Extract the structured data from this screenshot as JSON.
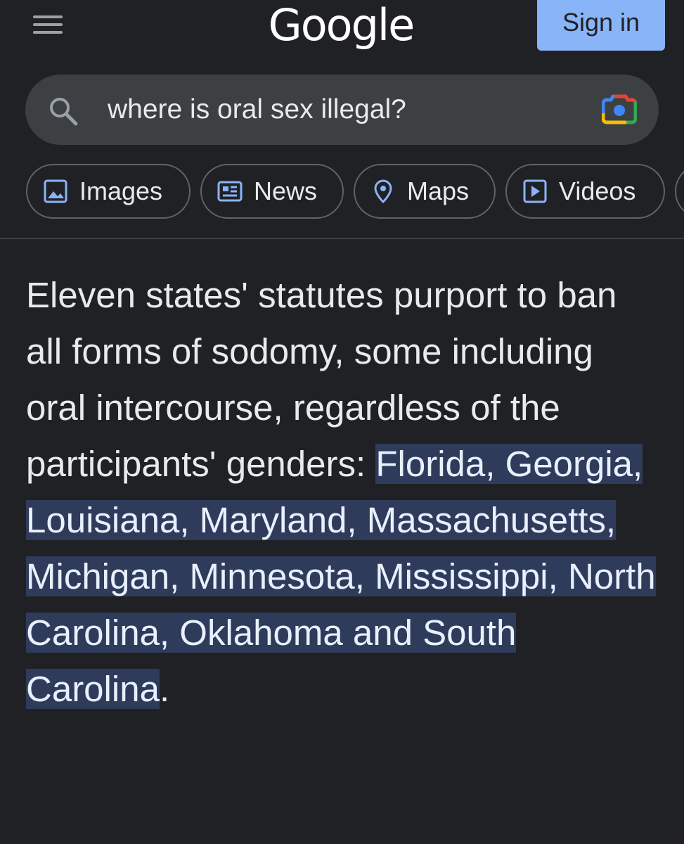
{
  "header": {
    "logo_text": "Google",
    "signin_label": "Sign in"
  },
  "search": {
    "query": "where is oral sex illegal?"
  },
  "tabs": [
    {
      "label": "Images",
      "icon": "image-icon"
    },
    {
      "label": "News",
      "icon": "newspaper-icon"
    },
    {
      "label": "Maps",
      "icon": "map-pin-icon"
    },
    {
      "label": "Videos",
      "icon": "play-icon"
    }
  ],
  "answer": {
    "lead_text": "Eleven states' statutes purport to ban all forms of sodomy, some including oral intercourse, regardless of the participants' genders: ",
    "highlight_text": "Florida, Georgia, Louisiana, Maryland, Massachusetts, Michigan, Minnesota, Mississippi, North Carolina, Oklahoma and South Carolina",
    "trail_text": "."
  },
  "colors": {
    "background": "#202124",
    "search_bg": "#3c4043",
    "signin_bg": "#8ab4f8",
    "highlight_bg": "#2f3b5a",
    "chip_icon": "#8ab4f8"
  }
}
